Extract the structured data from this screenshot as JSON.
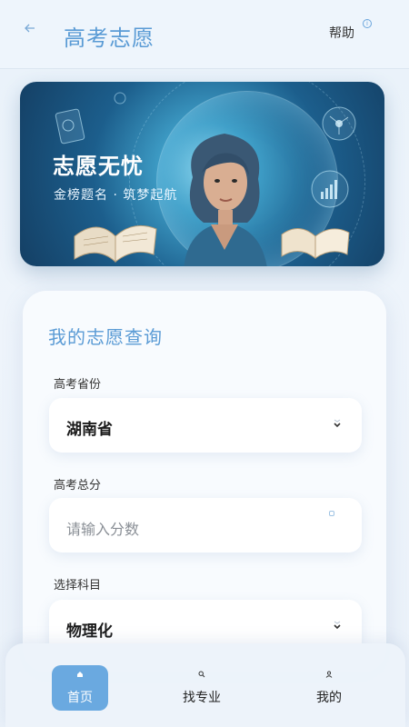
{
  "header": {
    "back_icon": "arrow-left-icon",
    "title": "高考志愿",
    "help_label": "帮助",
    "help_icon": "info-circle-icon"
  },
  "banner": {
    "title": "志愿无忧",
    "subtitle": "金榜题名 · 筑梦起航"
  },
  "form": {
    "title": "我的志愿查询",
    "province": {
      "label": "高考省份",
      "value": "湖南省"
    },
    "score": {
      "label": "高考总分",
      "placeholder": "请输入分数"
    },
    "subjects": {
      "label": "选择科目",
      "value": "物理化"
    }
  },
  "nav": {
    "items": [
      {
        "label": "首页",
        "icon": "home-icon",
        "active": true
      },
      {
        "label": "找专业",
        "icon": "search-icon",
        "active": false
      },
      {
        "label": "我的",
        "icon": "user-icon",
        "active": false
      }
    ]
  },
  "colors": {
    "accent": "#5a9bd5",
    "nav_active": "#6aa9e0",
    "banner_dark": "#143f64"
  }
}
